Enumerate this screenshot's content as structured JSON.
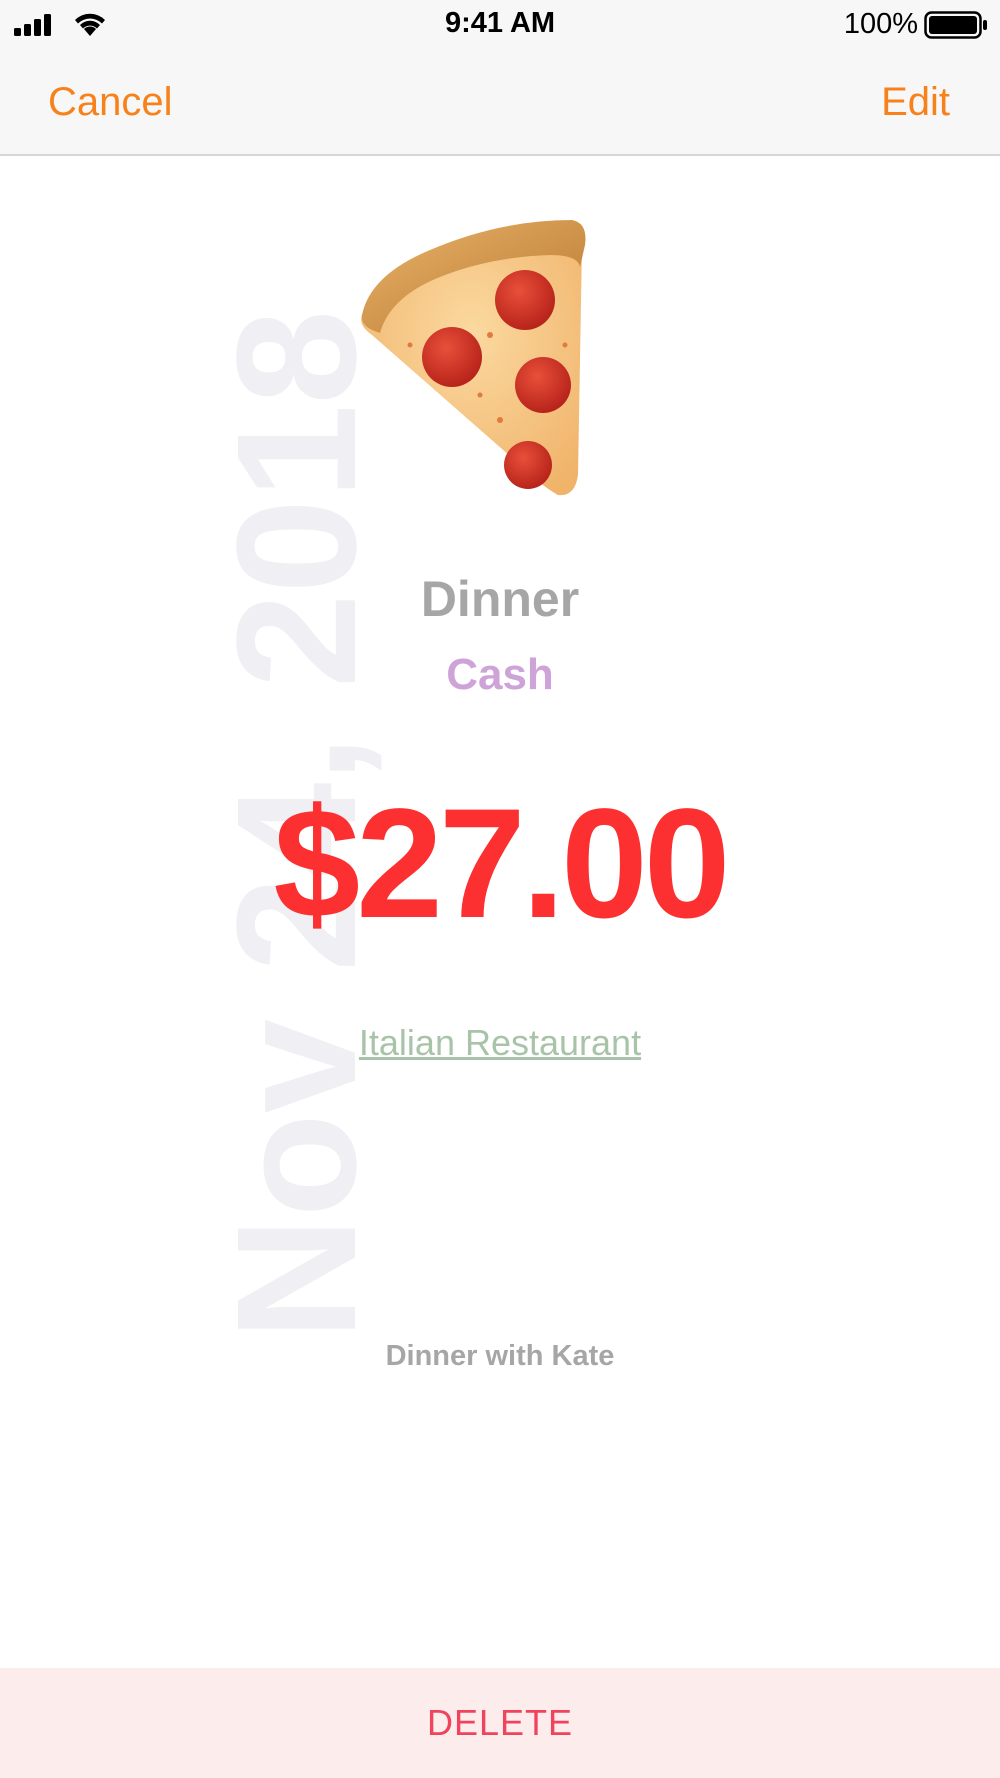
{
  "status_bar": {
    "time": "9:41 AM",
    "battery_percent": "100%",
    "icons": [
      "signal-icon",
      "wifi-icon",
      "battery-icon"
    ]
  },
  "nav": {
    "cancel_label": "Cancel",
    "edit_label": "Edit",
    "accent_color": "#f7821b"
  },
  "expense": {
    "date": "Nov 24, 2018",
    "icon": "pizza-icon",
    "category": "Dinner",
    "payment_method": "Cash",
    "amount": "$27.00",
    "location": "Italian Restaurant",
    "note": "Dinner with Kate",
    "amount_color": "#fc3030",
    "payment_color": "#cea3d8",
    "location_color": "#a9c3a9"
  },
  "footer": {
    "delete_label": "DELETE",
    "delete_color": "#f0445e"
  }
}
